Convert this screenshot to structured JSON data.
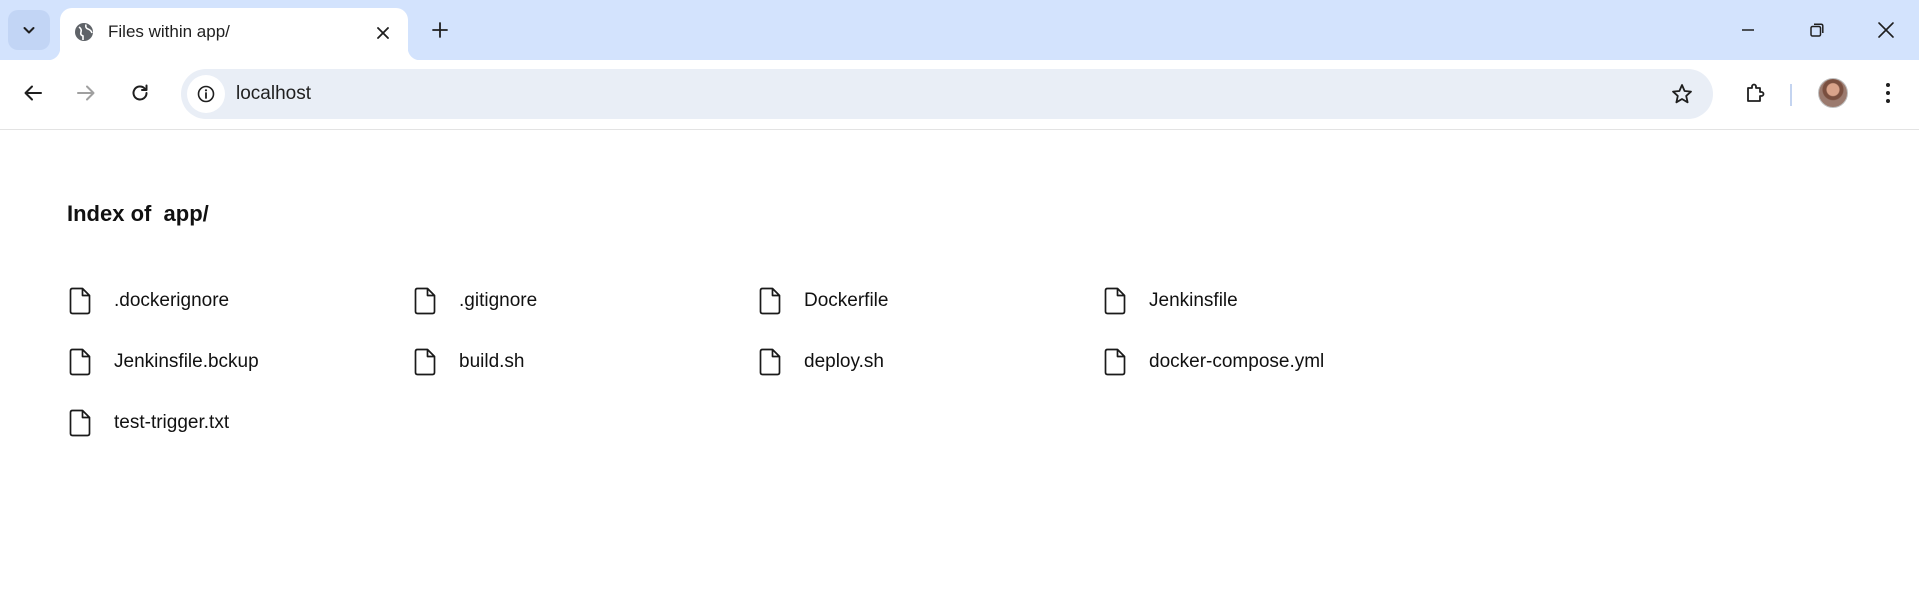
{
  "browser": {
    "tab": {
      "title": "Files within app/",
      "favicon": "globe-icon"
    },
    "address": {
      "url": "localhost"
    },
    "icons": {
      "tab_search": "chevron-down-icon",
      "tab_close": "close-icon",
      "new_tab": "plus-icon",
      "back": "arrow-left-icon",
      "forward": "arrow-right-icon",
      "reload": "reload-icon",
      "site_info": "info-icon",
      "bookmark": "star-icon",
      "extensions": "puzzle-icon",
      "profile": "avatar",
      "menu": "kebab-menu-icon",
      "minimize": "minimize-icon",
      "maximize": "restore-icon",
      "close_window": "close-icon"
    }
  },
  "page": {
    "heading": "Index of  app/",
    "files": [
      {
        "name": ".dockerignore",
        "icon": "file-icon"
      },
      {
        "name": ".gitignore",
        "icon": "file-icon"
      },
      {
        "name": "Dockerfile",
        "icon": "file-icon"
      },
      {
        "name": "Jenkinsfile",
        "icon": "file-icon"
      },
      {
        "name": "Jenkinsfile.bckup",
        "icon": "file-icon"
      },
      {
        "name": "build.sh",
        "icon": "file-icon"
      },
      {
        "name": "deploy.sh",
        "icon": "file-icon"
      },
      {
        "name": "docker-compose.yml",
        "icon": "file-icon"
      },
      {
        "name": "test-trigger.txt",
        "icon": "file-icon"
      }
    ]
  }
}
